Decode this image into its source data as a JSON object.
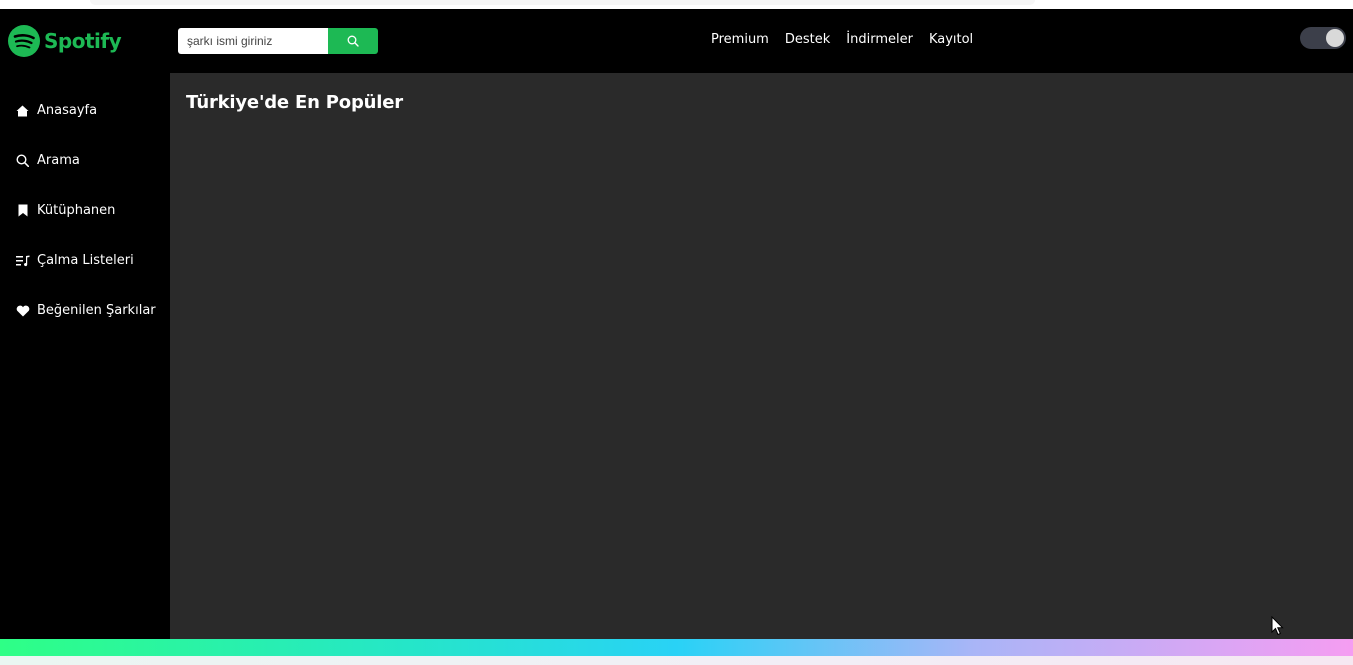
{
  "header": {
    "logo_text": "Spotify",
    "brand_color": "#1db954",
    "search": {
      "placeholder": "şarkı ismi giriniz",
      "button_icon": "search-icon"
    },
    "nav": [
      "Premium",
      "Destek",
      "İndirmeler",
      "Kayıtol"
    ],
    "theme_toggle": {
      "icon": "toggle-switch",
      "state": "on"
    }
  },
  "sidebar": {
    "items": [
      {
        "label": "Anasayfa",
        "icon": "home-icon"
      },
      {
        "label": "Arama",
        "icon": "search-icon"
      },
      {
        "label": "Kütüphanen",
        "icon": "bookmark-icon"
      },
      {
        "label": "Çalma Listeleri",
        "icon": "playlist-icon"
      },
      {
        "label": "Beğenilen Şarkılar",
        "icon": "heart-icon"
      }
    ]
  },
  "main": {
    "title": "Türkiye'de En Popüler"
  },
  "colors": {
    "header_bg": "#000000",
    "main_bg": "#2a2a2a",
    "text": "#ffffff"
  }
}
